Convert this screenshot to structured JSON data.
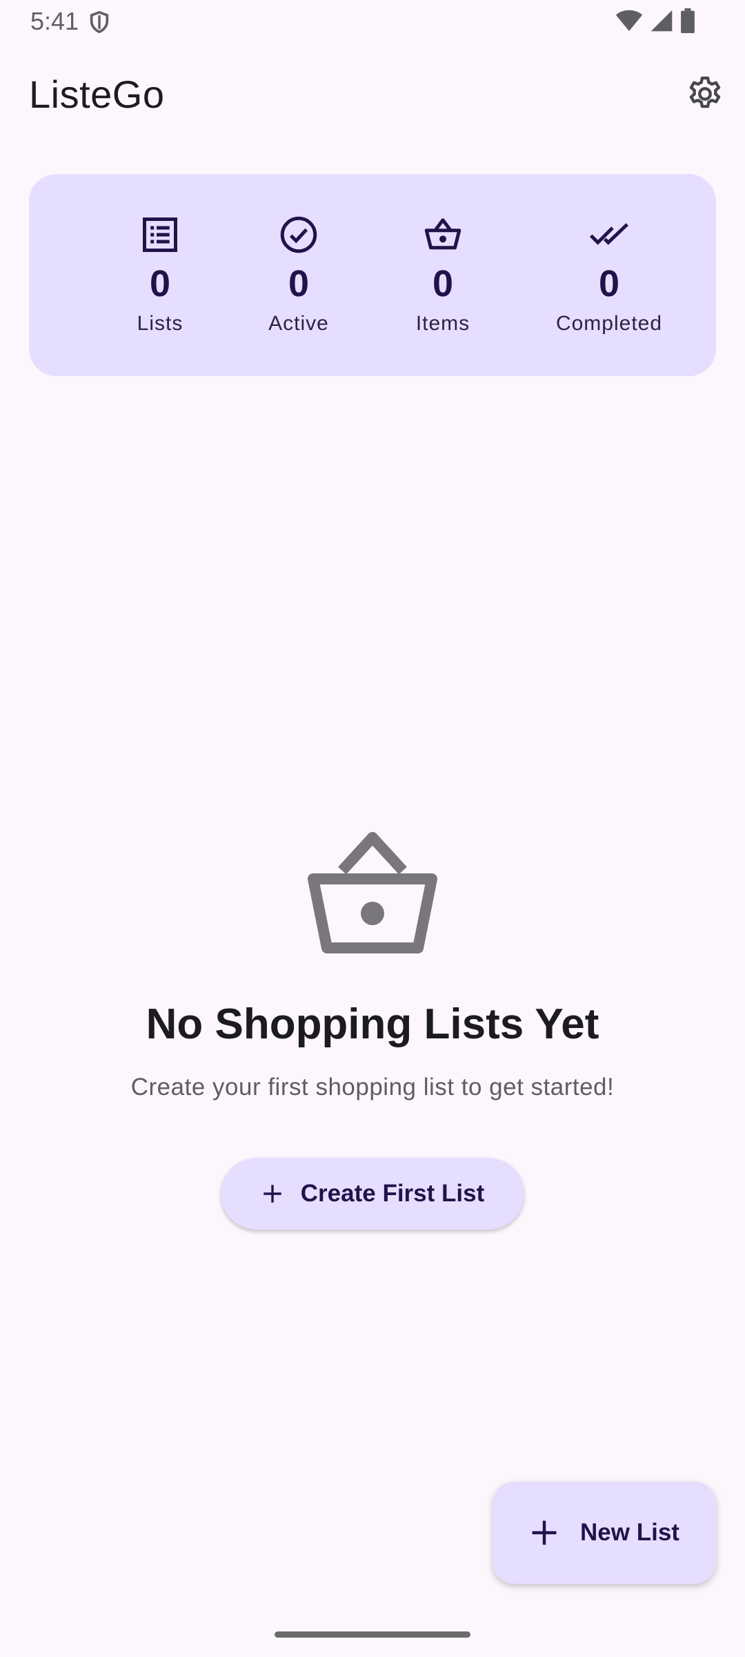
{
  "status_bar": {
    "time": "5:41",
    "icons": [
      "shield-icon",
      "wifi-icon",
      "cellular-icon",
      "battery-icon"
    ]
  },
  "app_bar": {
    "title": "ListeGo",
    "settings_icon": "gear-icon"
  },
  "stats": [
    {
      "icon": "list-icon",
      "value": "0",
      "label": "Lists"
    },
    {
      "icon": "check-circle-icon",
      "value": "0",
      "label": "Active"
    },
    {
      "icon": "basket-icon",
      "value": "0",
      "label": "Items"
    },
    {
      "icon": "double-check-icon",
      "value": "0",
      "label": "Completed"
    }
  ],
  "empty_state": {
    "icon": "basket-icon",
    "title": "No Shopping Lists Yet",
    "subtitle": "Create your first shopping list to get started!",
    "button_label": "Create First List",
    "button_icon": "plus-icon"
  },
  "fab": {
    "label": "New List",
    "icon": "plus-icon"
  },
  "colors": {
    "background": "#fdf7fd",
    "card": "#e6deff",
    "accent_text": "#21134a",
    "empty_icon": "#79767d"
  }
}
